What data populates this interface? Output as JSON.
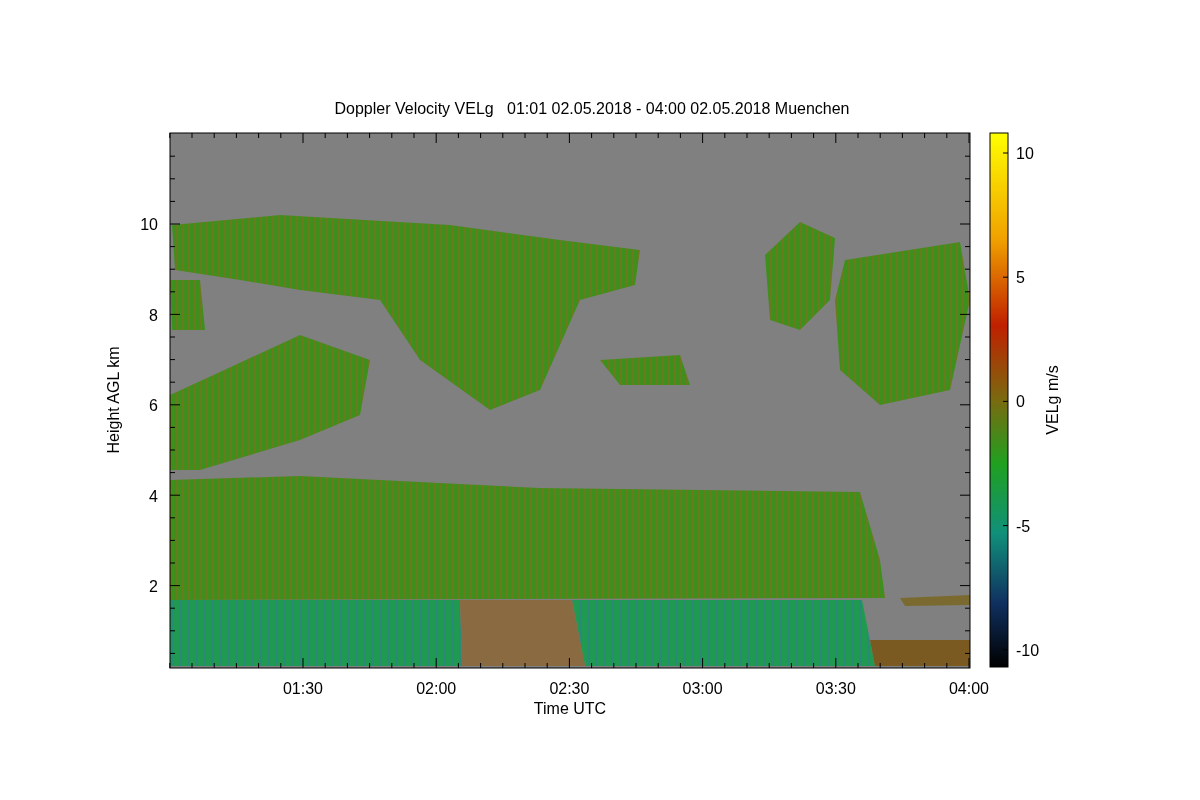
{
  "title": "Doppler Velocity VELg   01:01 02.05.2018 - 04:00 02.05.2018 Muenchen",
  "y_axis": {
    "label": "Height AGL km",
    "ticks": [
      "10",
      "8",
      "6",
      "4",
      "2"
    ]
  },
  "x_axis": {
    "label": "Time UTC",
    "ticks": [
      "01:30",
      "02:00",
      "02:30",
      "03:00",
      "03:30",
      "04:00"
    ]
  },
  "colorbar": {
    "label": "VELg m/s",
    "ticks": [
      "10",
      "5",
      "0",
      "-5",
      "-10"
    ]
  }
}
